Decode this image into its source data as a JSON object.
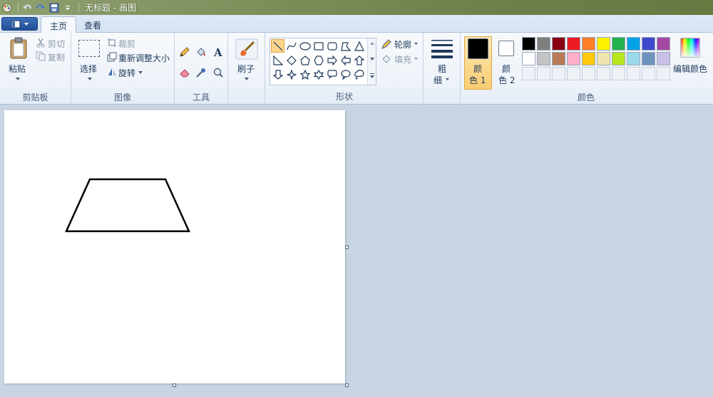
{
  "window": {
    "title": "无标题 - 画图"
  },
  "tabs": [
    {
      "label": "主页",
      "active": true
    },
    {
      "label": "查看",
      "active": false
    }
  ],
  "clipboard": {
    "paste_label": "粘贴",
    "cut_label": "剪切",
    "copy_label": "复制",
    "group_label": "剪贴板"
  },
  "image": {
    "select_label": "选择",
    "crop_label": "裁剪",
    "resize_label": "重新调整大小",
    "rotate_label": "旋转",
    "group_label": "图像"
  },
  "tools": {
    "group_label": "工具",
    "items": [
      "pencil-icon",
      "fill-icon",
      "text-icon",
      "eraser-icon",
      "color-picker-icon",
      "magnifier-icon"
    ]
  },
  "brushes": {
    "label": "刷子"
  },
  "shapes": {
    "group_label": "形状",
    "outline_label": "轮廓",
    "fill_label": "填充",
    "items": [
      "line",
      "curve",
      "oval",
      "rectangle",
      "rounded-rectangle",
      "polygon",
      "triangle",
      "right-triangle",
      "diamond",
      "pentagon",
      "hexagon",
      "right-arrow",
      "left-arrow",
      "up-arrow",
      "down-arrow",
      "four-point-star",
      "five-point-star",
      "six-point-star",
      "rounded-callout",
      "oval-callout",
      "cloud-callout"
    ]
  },
  "size": {
    "label_line1": "粗",
    "label_line2": "细"
  },
  "colors": {
    "group_label": "颜色",
    "color1_line1": "颜",
    "color1_line2": "色 1",
    "color2_line1": "颜",
    "color2_line2": "色 2",
    "color1_value": "#000000",
    "color2_value": "#ffffff",
    "edit_label": "编辑颜色",
    "palette_row1": [
      "#000000",
      "#7f7f7f",
      "#880015",
      "#ed1c24",
      "#ff7f27",
      "#fff200",
      "#22b14c",
      "#00a2e8",
      "#3f48cc",
      "#a349a4"
    ],
    "palette_row2": [
      "#ffffff",
      "#c3c3c3",
      "#b97a57",
      "#ffaec9",
      "#ffc90e",
      "#efe4b0",
      "#b5e61d",
      "#99d9ea",
      "#7092be",
      "#c8bfe7"
    ]
  },
  "drawing": {
    "shape": "trapezoid",
    "stroke_color": "#000000"
  }
}
